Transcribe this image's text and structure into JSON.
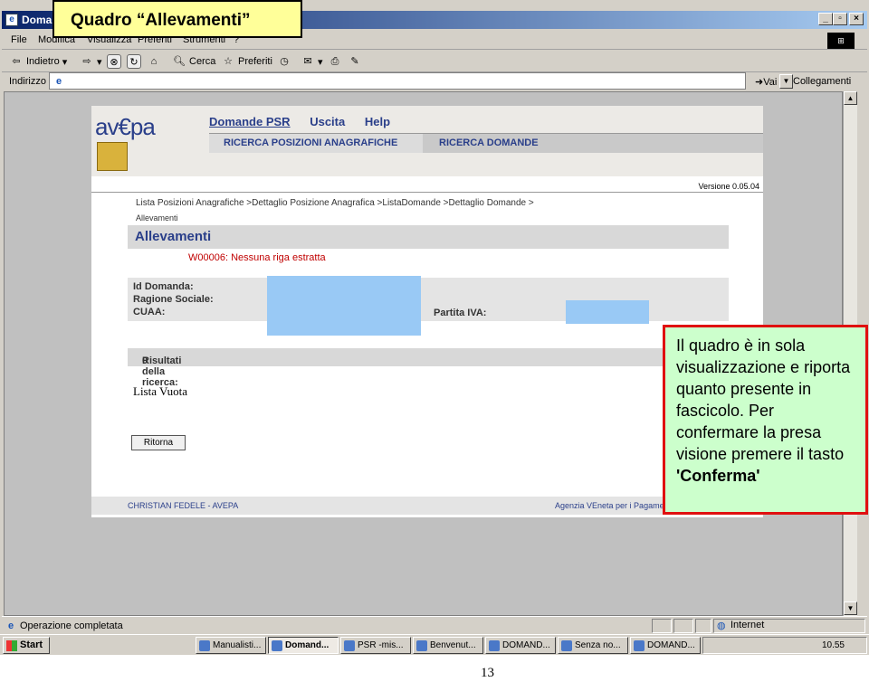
{
  "browser": {
    "title": "Domar",
    "menu": [
      "File",
      "Modifica",
      "Visualizza",
      "Preferiti",
      "Strumenti",
      "?"
    ],
    "toolbar": {
      "back": "Indietro",
      "search": "Cerca",
      "favorites": "Preferiti"
    },
    "address_label": "Indirizzo",
    "go_label": "Vai",
    "links_label": "Collegamenti",
    "status_text": "Operazione completata",
    "zone": "Internet"
  },
  "app": {
    "logo": "av€pa",
    "nav": [
      "Domande PSR",
      "Uscita",
      "Help"
    ],
    "subnav": [
      "RICERCA POSIZIONI ANAGRAFICHE",
      "RICERCA DOMANDE"
    ],
    "version": "Versione 0.05.04",
    "breadcrumb": "Lista Posizioni Anagrafiche >Dettaglio Posizione Anagrafica >ListaDomande >Dettaglio Domande >",
    "breadcrumb2": "Allevamenti",
    "section_title": "Allevamenti",
    "error": "W00006: Nessuna riga estratta",
    "fields": {
      "id": "Id Domanda:",
      "ragione": "Ragione Sociale:",
      "cuaa": "CUAA:",
      "piva": "Partita IVA:"
    },
    "results_label": "Risultati della ricerca:",
    "results_count": "0",
    "empty_list": "Lista Vuota",
    "back_button": "Ritorna",
    "footer_left": "CHRISTIAN FEDELE - AVEPA",
    "footer_right": "Agenzia VEneta per i Pagame"
  },
  "taskbar": {
    "start": "Start",
    "tasks": [
      "Manualisti...",
      "Domand...",
      "PSR -mis...",
      "Benvenut...",
      "DOMAND...",
      "Senza no...",
      "DOMAND..."
    ],
    "clock": "10.55"
  },
  "overlay": {
    "title": "Quadro “Allevamenti”",
    "callout": "Il quadro è in sola visualizzazione e riporta quanto presente in fascicolo. Per confermare la presa visione premere il tasto",
    "callout_bold": "'Conferma'",
    "page_number": "13"
  }
}
